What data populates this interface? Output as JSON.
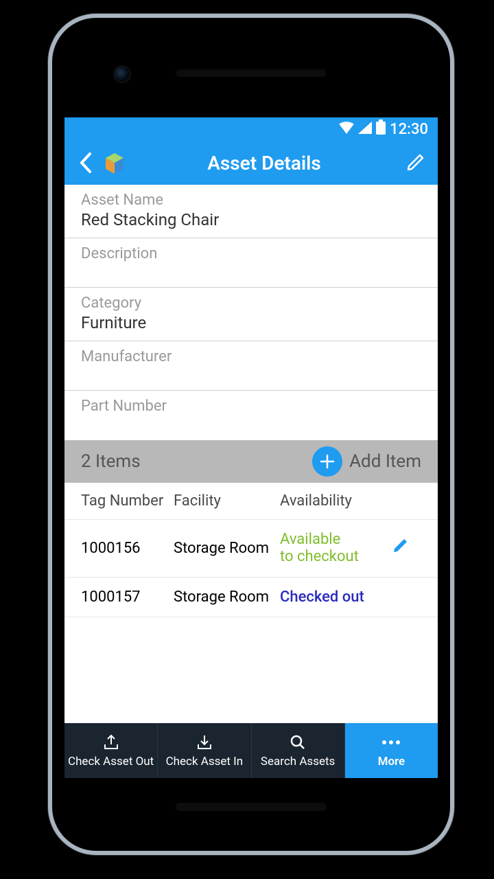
{
  "status": {
    "time": "12:30"
  },
  "appbar": {
    "title": "Asset Details"
  },
  "fields": {
    "asset_name": {
      "label": "Asset Name",
      "value": "Red Stacking Chair"
    },
    "description": {
      "label": "Description",
      "value": ""
    },
    "category": {
      "label": "Category",
      "value": "Furniture"
    },
    "manufacturer": {
      "label": "Manufacturer",
      "value": ""
    },
    "part_number": {
      "label": "Part Number",
      "value": ""
    }
  },
  "items_bar": {
    "count": "2 Items",
    "add_label": "Add Item"
  },
  "table": {
    "headers": {
      "tag": "Tag Number",
      "facility": "Facility",
      "availability": "Availability"
    },
    "rows": [
      {
        "tag": "1000156",
        "facility": "Storage Room",
        "availability_l1": "Available",
        "availability_l2": "to checkout",
        "status": "available"
      },
      {
        "tag": "1000157",
        "facility": "Storage Room",
        "availability_l1": "Checked out",
        "availability_l2": "",
        "status": "checked_out"
      }
    ]
  },
  "nav": {
    "out": "Check Asset Out",
    "in": "Check Asset In",
    "search": "Search Assets",
    "more": "More"
  }
}
